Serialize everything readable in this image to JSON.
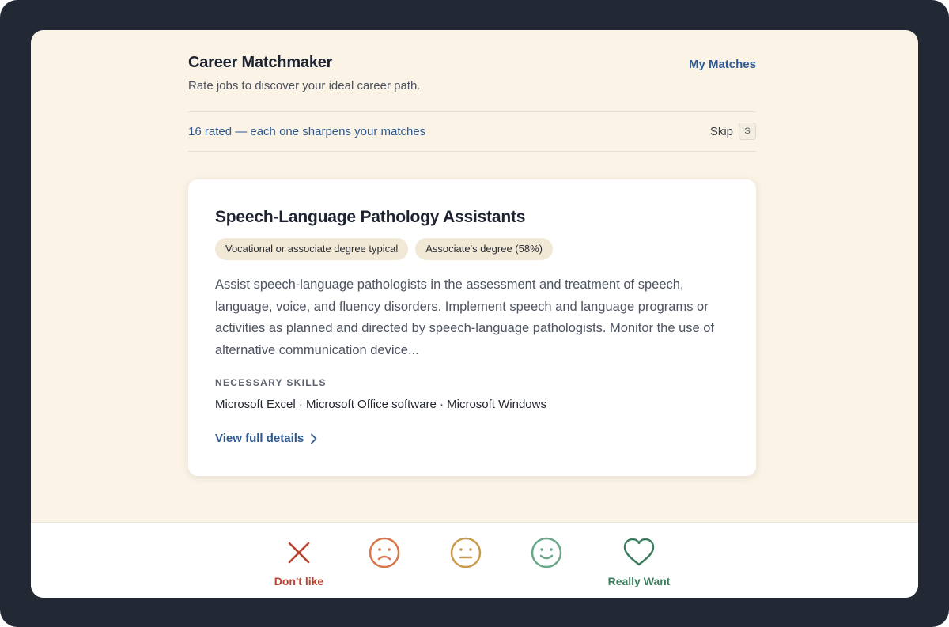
{
  "app": {
    "title": "Career Matchmaker",
    "subtitle": "Rate jobs to discover your ideal career path.",
    "my_matches_label": "My Matches"
  },
  "progress": {
    "text": "16 rated — each one sharpens your matches",
    "skip_label": "Skip",
    "skip_shortcut": "S"
  },
  "job": {
    "title": "Speech-Language Pathology Assistants",
    "tags": [
      "Vocational or associate degree typical",
      "Associate's degree (58%)"
    ],
    "description": "Assist speech-language pathologists in the assessment and treatment of speech, language, voice, and fluency disorders. Implement speech and language programs or activities as planned and directed by speech-language pathologists. Monitor the use of alternative communication device...",
    "skills_heading": "NECESSARY SKILLS",
    "skills": "Microsoft Excel · Microsoft Office software · Microsoft Windows",
    "view_details_label": "View full details"
  },
  "ratings": [
    {
      "icon": "x-icon",
      "label": "Don't like",
      "color": "#b8432f"
    },
    {
      "icon": "frown-face-icon",
      "label": "",
      "color": "#d9764a"
    },
    {
      "icon": "neutral-face-icon",
      "label": "",
      "color": "#c99a4a"
    },
    {
      "icon": "smile-face-icon",
      "label": "",
      "color": "#6aa88a"
    },
    {
      "icon": "heart-icon",
      "label": "Really Want",
      "color": "#3d7d5e"
    }
  ],
  "colors": {
    "frame": "#222834",
    "background": "#faf3e6",
    "accent_link": "#2e5a94",
    "tag_bg": "#f1e8d6"
  }
}
